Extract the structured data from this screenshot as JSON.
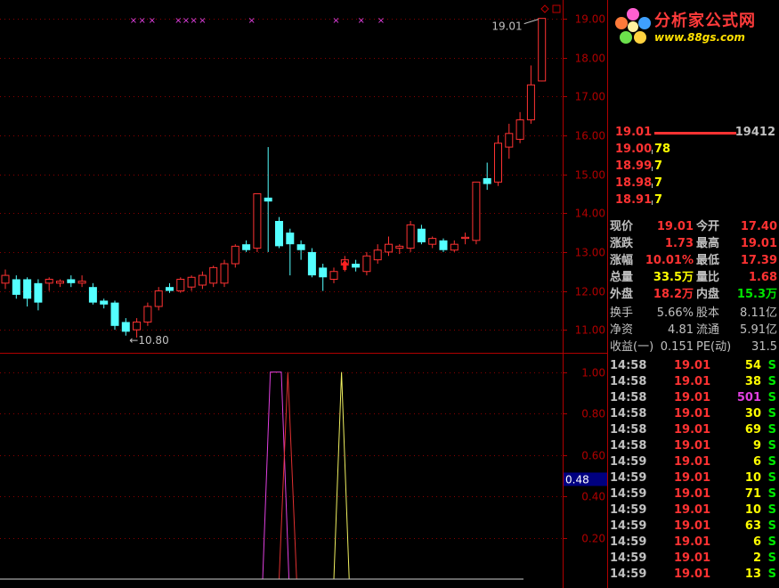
{
  "logo": {
    "text": "分析家公式网",
    "url": "www.88gs.com"
  },
  "main_chart": {
    "price_ticks": [
      "19.00",
      "18.00",
      "17.00",
      "16.00",
      "15.00",
      "14.00",
      "13.00",
      "12.00",
      "11.00"
    ],
    "high_label": "19.01",
    "low_label": "←10.80"
  },
  "indicator": {
    "ticks": [
      "1.00",
      "0.80",
      "0.60",
      "0.40",
      "0.20"
    ],
    "current_value": "0.48"
  },
  "order_book": [
    {
      "price": "19.01",
      "volume": "19412"
    },
    {
      "price": "19.00",
      "volume": "78"
    },
    {
      "price": "18.99",
      "volume": "7"
    },
    {
      "price": "18.98",
      "volume": "7"
    },
    {
      "price": "18.91",
      "volume": "7"
    }
  ],
  "quote": [
    {
      "l1": "现价",
      "v1": "19.01",
      "l2": "今开",
      "v2": "17.40"
    },
    {
      "l1": "涨跌",
      "v1": "1.73",
      "l2": "最高",
      "v2": "19.01"
    },
    {
      "l1": "涨幅",
      "v1": "10.01%",
      "l2": "最低",
      "v2": "17.39"
    },
    {
      "l1": "总量",
      "v1": "33.5万",
      "l2": "量比",
      "v2": "1.68"
    },
    {
      "l1": "外盘",
      "v1": "18.2万",
      "l2": "内盘",
      "v2": "15.3万"
    }
  ],
  "fundamentals": [
    {
      "l1": "换手",
      "v1": "5.66%",
      "l2": "股本",
      "v2": "8.11亿"
    },
    {
      "l1": "净资",
      "v1": "4.81",
      "l2": "流通",
      "v2": "5.91亿"
    },
    {
      "l1": "收益(一)",
      "v1": "0.151",
      "l2": "PE(动)",
      "v2": "31.5"
    }
  ],
  "ticks": [
    {
      "time": "14:58",
      "price": "19.01",
      "vol": "54",
      "side": "S"
    },
    {
      "time": "14:58",
      "price": "19.01",
      "vol": "38",
      "side": "S"
    },
    {
      "time": "14:58",
      "price": "19.01",
      "vol": "501",
      "side": "S"
    },
    {
      "time": "14:58",
      "price": "19.01",
      "vol": "30",
      "side": "S"
    },
    {
      "time": "14:58",
      "price": "19.01",
      "vol": "69",
      "side": "S"
    },
    {
      "time": "14:58",
      "price": "19.01",
      "vol": "9",
      "side": "S"
    },
    {
      "time": "14:59",
      "price": "19.01",
      "vol": "6",
      "side": "S"
    },
    {
      "time": "14:59",
      "price": "19.01",
      "vol": "10",
      "side": "S"
    },
    {
      "time": "14:59",
      "price": "19.01",
      "vol": "71",
      "side": "S"
    },
    {
      "time": "14:59",
      "price": "19.01",
      "vol": "10",
      "side": "S"
    },
    {
      "time": "14:59",
      "price": "19.01",
      "vol": "63",
      "side": "S"
    },
    {
      "time": "14:59",
      "price": "19.01",
      "vol": "6",
      "side": "S"
    },
    {
      "time": "14:59",
      "price": "19.01",
      "vol": "2",
      "side": "S"
    },
    {
      "time": "14:59",
      "price": "19.01",
      "vol": "13",
      "side": "S"
    }
  ],
  "chart_data": {
    "type": "candlestick",
    "ylim": [
      10.5,
      19.3
    ],
    "candles": [
      {
        "o": 12.2,
        "h": 12.55,
        "l": 12.05,
        "c": 12.4
      },
      {
        "o": 12.3,
        "h": 12.4,
        "l": 11.8,
        "c": 11.9
      },
      {
        "o": 12.3,
        "h": 12.35,
        "l": 11.6,
        "c": 11.8
      },
      {
        "o": 12.2,
        "h": 12.3,
        "l": 11.5,
        "c": 11.7
      },
      {
        "o": 12.2,
        "h": 12.35,
        "l": 12.0,
        "c": 12.3
      },
      {
        "o": 12.2,
        "h": 12.3,
        "l": 12.1,
        "c": 12.25
      },
      {
        "o": 12.3,
        "h": 12.4,
        "l": 12.1,
        "c": 12.2
      },
      {
        "o": 12.2,
        "h": 12.4,
        "l": 12.1,
        "c": 12.25
      },
      {
        "o": 12.1,
        "h": 12.2,
        "l": 11.65,
        "c": 11.7
      },
      {
        "o": 11.75,
        "h": 11.8,
        "l": 11.55,
        "c": 11.65
      },
      {
        "o": 11.7,
        "h": 11.75,
        "l": 11.0,
        "c": 11.1
      },
      {
        "o": 11.2,
        "h": 11.3,
        "l": 10.85,
        "c": 10.95
      },
      {
        "o": 11.0,
        "h": 11.3,
        "l": 10.8,
        "c": 11.2
      },
      {
        "o": 11.2,
        "h": 11.7,
        "l": 11.1,
        "c": 11.6
      },
      {
        "o": 11.6,
        "h": 12.1,
        "l": 11.5,
        "c": 12.0
      },
      {
        "o": 12.1,
        "h": 12.2,
        "l": 11.95,
        "c": 12.0
      },
      {
        "o": 12.0,
        "h": 12.35,
        "l": 11.95,
        "c": 12.3
      },
      {
        "o": 12.1,
        "h": 12.4,
        "l": 12.0,
        "c": 12.35
      },
      {
        "o": 12.15,
        "h": 12.5,
        "l": 12.05,
        "c": 12.4
      },
      {
        "o": 12.2,
        "h": 12.65,
        "l": 12.1,
        "c": 12.6
      },
      {
        "o": 12.2,
        "h": 12.8,
        "l": 12.1,
        "c": 12.7
      },
      {
        "o": 12.7,
        "h": 13.2,
        "l": 12.6,
        "c": 13.15
      },
      {
        "o": 13.2,
        "h": 13.3,
        "l": 13.0,
        "c": 13.05
      },
      {
        "o": 13.1,
        "h": 14.5,
        "l": 13.0,
        "c": 14.5
      },
      {
        "o": 14.4,
        "h": 15.7,
        "l": 13.0,
        "c": 14.3
      },
      {
        "o": 13.8,
        "h": 13.9,
        "l": 13.1,
        "c": 13.15
      },
      {
        "o": 13.5,
        "h": 13.6,
        "l": 12.4,
        "c": 13.2
      },
      {
        "o": 13.2,
        "h": 13.3,
        "l": 12.8,
        "c": 13.05
      },
      {
        "o": 13.0,
        "h": 13.1,
        "l": 12.35,
        "c": 12.4
      },
      {
        "o": 12.6,
        "h": 12.7,
        "l": 12.0,
        "c": 12.35
      },
      {
        "o": 12.3,
        "h": 12.6,
        "l": 12.2,
        "c": 12.5
      },
      {
        "o": 12.7,
        "h": 12.9,
        "l": 12.5,
        "c": 12.8
      },
      {
        "o": 12.7,
        "h": 12.8,
        "l": 12.5,
        "c": 12.6
      },
      {
        "o": 12.5,
        "h": 13.0,
        "l": 12.4,
        "c": 12.9
      },
      {
        "o": 12.8,
        "h": 13.2,
        "l": 12.7,
        "c": 13.05
      },
      {
        "o": 13.0,
        "h": 13.4,
        "l": 12.9,
        "c": 13.2
      },
      {
        "o": 13.1,
        "h": 13.2,
        "l": 12.95,
        "c": 13.15
      },
      {
        "o": 13.1,
        "h": 13.8,
        "l": 13.0,
        "c": 13.7
      },
      {
        "o": 13.6,
        "h": 13.7,
        "l": 13.2,
        "c": 13.25
      },
      {
        "o": 13.2,
        "h": 13.4,
        "l": 13.1,
        "c": 13.35
      },
      {
        "o": 13.3,
        "h": 13.35,
        "l": 13.0,
        "c": 13.05
      },
      {
        "o": 13.05,
        "h": 13.3,
        "l": 13.0,
        "c": 13.2
      },
      {
        "o": 13.35,
        "h": 13.5,
        "l": 13.2,
        "c": 13.38
      },
      {
        "o": 13.3,
        "h": 14.8,
        "l": 13.2,
        "c": 14.8
      },
      {
        "o": 14.9,
        "h": 15.3,
        "l": 14.6,
        "c": 14.75
      },
      {
        "o": 14.8,
        "h": 16.0,
        "l": 14.7,
        "c": 15.8
      },
      {
        "o": 15.7,
        "h": 16.3,
        "l": 15.4,
        "c": 16.05
      },
      {
        "o": 15.9,
        "h": 16.6,
        "l": 15.8,
        "c": 16.4
      },
      {
        "o": 16.4,
        "h": 17.8,
        "l": 16.3,
        "c": 17.3
      },
      {
        "o": 17.4,
        "h": 19.01,
        "l": 17.39,
        "c": 19.01
      }
    ]
  },
  "indicator_data": {
    "type": "line",
    "ylim": [
      0,
      1.05
    ],
    "series": [
      {
        "color": "#e040e0",
        "points": [
          [
            23.5,
            0
          ],
          [
            24.2,
            1.0
          ],
          [
            25.2,
            1.0
          ],
          [
            25.9,
            0
          ]
        ]
      },
      {
        "color": "#e03030",
        "points": [
          [
            25.0,
            0
          ],
          [
            25.8,
            1.0
          ],
          [
            26.6,
            0
          ]
        ]
      },
      {
        "color": "#f0f060",
        "points": [
          [
            30.0,
            0
          ],
          [
            30.7,
            1.0
          ],
          [
            31.4,
            0
          ]
        ]
      }
    ]
  },
  "markers": {
    "color": "#e040e0",
    "positions": [
      11.7,
      12.5,
      13.4,
      15.8,
      16.5,
      17.2,
      18.0,
      22.5,
      30.2,
      32.5,
      34.3
    ]
  },
  "buy_arrow_position": 31.0,
  "colors": {
    "up": "#ff3232",
    "down": "#54ffff",
    "axis": "#b00000",
    "text": "#c0c0c0"
  }
}
